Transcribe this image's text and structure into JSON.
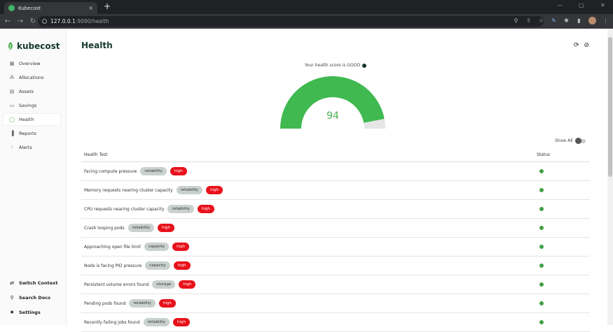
{
  "browser": {
    "tab_title": "Kubecost",
    "tab_close": "×",
    "new_tab": "+",
    "url_host": "127.0.0.1",
    "url_rest": ":9090/health"
  },
  "sidebar": {
    "logo": "kubecost",
    "items": [
      {
        "label": "Overview",
        "icon": "grid-icon"
      },
      {
        "label": "Allocations",
        "icon": "allocations-icon"
      },
      {
        "label": "Assets",
        "icon": "assets-icon"
      },
      {
        "label": "Savings",
        "icon": "savings-icon"
      },
      {
        "label": "Health",
        "icon": "health-icon"
      },
      {
        "label": "Reports",
        "icon": "reports-icon"
      },
      {
        "label": "Alerts",
        "icon": "bell-icon"
      }
    ],
    "bottom": [
      {
        "label": "Switch Context",
        "icon": "switch-icon"
      },
      {
        "label": "Search Docs",
        "icon": "search-icon"
      },
      {
        "label": "Settings",
        "icon": "gear-icon"
      }
    ]
  },
  "page": {
    "title": "Health",
    "score_text": "Your health score is GOOD",
    "score": "94",
    "score_fraction": 0.94,
    "show_all": "Show All",
    "col_test": "Health Test",
    "col_status": "Status"
  },
  "rows": [
    {
      "name": "Facing compute pressure",
      "category": "reliability",
      "severity": "high"
    },
    {
      "name": "Memory requests nearing cluster capacity",
      "category": "reliability",
      "severity": "high"
    },
    {
      "name": "CPU requests nearing cluster capacity",
      "category": "reliability",
      "severity": "high"
    },
    {
      "name": "Crash looping pods",
      "category": "reliability",
      "severity": "high"
    },
    {
      "name": "Approaching open file limit",
      "category": "capacity",
      "severity": "high"
    },
    {
      "name": "Node is facing PID pressure",
      "category": "capacity",
      "severity": "high"
    },
    {
      "name": "Persistent volume errors found",
      "category": "storage",
      "severity": "high"
    },
    {
      "name": "Pending pods found",
      "category": "reliability",
      "severity": "high"
    },
    {
      "name": "Recently failing jobs found",
      "category": "reliability",
      "severity": "high"
    }
  ],
  "colors": {
    "brand_green": "#4caf50",
    "severity_high": "#e8121b",
    "ok_status": "#43a047"
  }
}
